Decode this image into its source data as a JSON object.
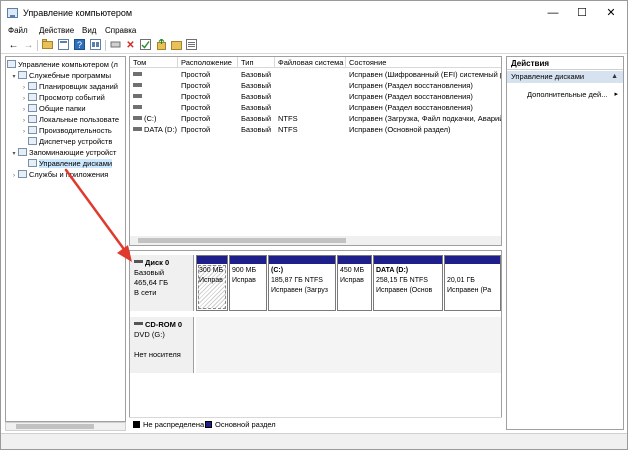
{
  "window": {
    "title": "Управление компьютером",
    "minimize": "—",
    "maximize": "☐",
    "close": "✕"
  },
  "menu": [
    "Файл",
    "Действие",
    "Вид",
    "Справка"
  ],
  "toolbar_icons": [
    "back-icon",
    "forward-icon",
    "folder-icon",
    "properties-icon",
    "help-icon",
    "view-icon",
    "connect-icon",
    "delete-icon",
    "check-icon",
    "export-icon",
    "open-icon",
    "list-icon"
  ],
  "tree": {
    "items": [
      {
        "label": "Управление компьютером (л",
        "twist": ""
      },
      {
        "label": "Служебные программы",
        "twist": "▾"
      },
      {
        "label": "Планировщик заданий",
        "twist": "›"
      },
      {
        "label": "Просмотр событий",
        "twist": "›"
      },
      {
        "label": "Общие папки",
        "twist": "›"
      },
      {
        "label": "Локальные пользовате",
        "twist": "›"
      },
      {
        "label": "Производительность",
        "twist": "›"
      },
      {
        "label": "Диспетчер устройств",
        "twist": ""
      },
      {
        "label": "Запоминающие устройст",
        "twist": "▾"
      },
      {
        "label": "Управление дисками",
        "twist": ""
      },
      {
        "label": "Службы и приложения",
        "twist": "›"
      }
    ]
  },
  "volume_list": {
    "columns": [
      "Том",
      "Расположение",
      "Тип",
      "Файловая система",
      "Состояние"
    ],
    "rows": [
      {
        "volume": "",
        "layout": "Простой",
        "type": "Базовый",
        "fs": "",
        "status": "Исправен (Шифрованный (EFI) системный р"
      },
      {
        "volume": "",
        "layout": "Простой",
        "type": "Базовый",
        "fs": "",
        "status": "Исправен (Раздел восстановления)"
      },
      {
        "volume": "",
        "layout": "Простой",
        "type": "Базовый",
        "fs": "",
        "status": "Исправен (Раздел восстановления)"
      },
      {
        "volume": "",
        "layout": "Простой",
        "type": "Базовый",
        "fs": "",
        "status": "Исправен (Раздел восстановления)"
      },
      {
        "volume": "(C:)",
        "layout": "Простой",
        "type": "Базовый",
        "fs": "NTFS",
        "status": "Исправен (Загрузка, Файл подкачки, Аварий"
      },
      {
        "volume": "DATA (D:)",
        "layout": "Простой",
        "type": "Базовый",
        "fs": "NTFS",
        "status": "Исправен (Основной раздел)"
      }
    ]
  },
  "disk0": {
    "name": "Диск 0",
    "kind": "Базовый",
    "size": "465,64 ГБ",
    "state": "В сети",
    "partitions": [
      {
        "name": "",
        "size": "300 МБ",
        "status": "Исправ"
      },
      {
        "name": "",
        "size": "900 МБ",
        "status": "Исправ"
      },
      {
        "name": "(C:)",
        "size": "185,87 ГБ NTFS",
        "status": "Исправен (Загруз"
      },
      {
        "name": "",
        "size": "450 МБ",
        "status": "Исправ"
      },
      {
        "name": "DATA (D:)",
        "size": "258,15 ГБ NTFS",
        "status": "Исправен (Основ"
      },
      {
        "name": "",
        "size": "20,01 ГБ",
        "status": "Исправен (Ра"
      }
    ]
  },
  "cdrom": {
    "name": "CD-ROM 0",
    "drive": "DVD (G:)",
    "state": "Нет носителя"
  },
  "legend": {
    "unallocated": "Не распределена",
    "primary": "Основной раздел"
  },
  "actions": {
    "title": "Действия",
    "section": "Управление дисками",
    "item": "Дополнительные дей...",
    "arrow_up": "▲",
    "arrow_right": "▸"
  },
  "colors": {
    "primary_partition": "#1f1f8c",
    "unallocated": "#000000",
    "annotation_arrow": "#e03a2f",
    "selection": "#cce8ff",
    "section_bg": "#d6e2f0"
  }
}
